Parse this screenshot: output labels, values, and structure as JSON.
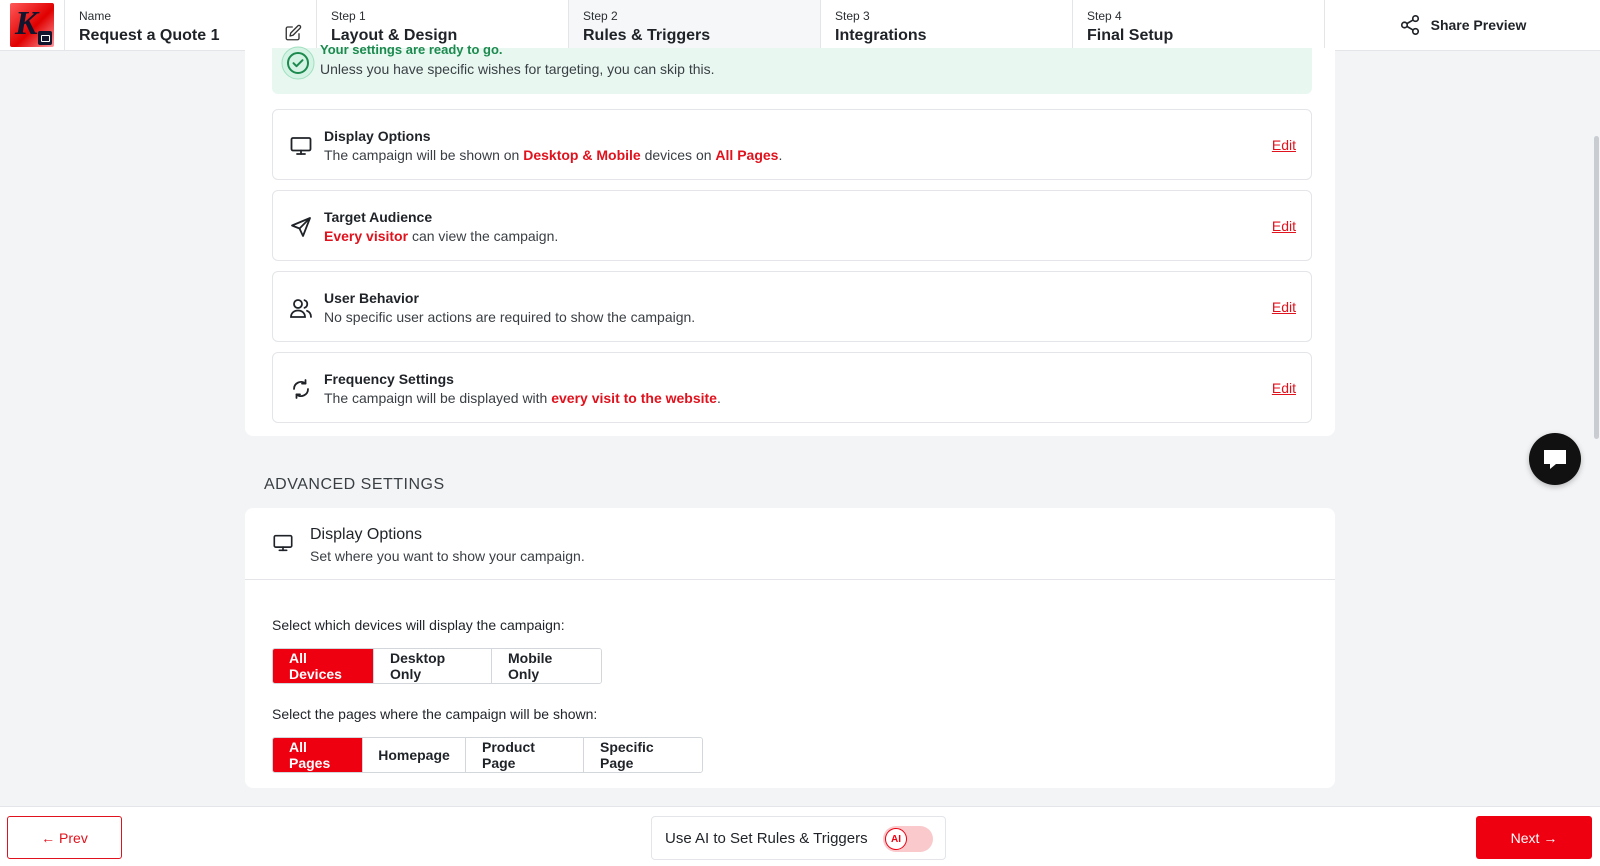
{
  "header": {
    "name_label": "Name",
    "name_value": "Request a Quote 1",
    "steps": [
      {
        "step": "Step 1",
        "title": "Layout & Design"
      },
      {
        "step": "Step 2",
        "title": "Rules & Triggers"
      },
      {
        "step": "Step 3",
        "title": "Integrations"
      },
      {
        "step": "Step 4",
        "title": "Final Setup"
      }
    ],
    "share_label": "Share Preview"
  },
  "ready_banner": {
    "title": "Your settings are ready to go.",
    "subtitle": "Unless you have specific wishes for targeting, you can skip this."
  },
  "summary_rows": [
    {
      "icon": "monitor-icon",
      "title": "Display Options",
      "desc_parts": [
        "The campaign will be shown on ",
        "Desktop & Mobile",
        " devices on ",
        "All Pages",
        "."
      ],
      "edit": "Edit"
    },
    {
      "icon": "send-icon",
      "title": "Target Audience",
      "desc_parts": [
        "Every visitor",
        " can view the campaign."
      ],
      "edit": "Edit"
    },
    {
      "icon": "users-icon",
      "title": "User Behavior",
      "desc_parts": [
        "No specific user actions are required to show the campaign."
      ],
      "edit": "Edit"
    },
    {
      "icon": "refresh-icon",
      "title": "Frequency Settings",
      "desc_parts": [
        "The campaign will be displayed with ",
        "every visit to the website",
        "."
      ],
      "edit": "Edit"
    }
  ],
  "advanced": {
    "section_label": "ADVANCED SETTINGS",
    "title": "Display Options",
    "subtitle": "Set where you want to show your campaign.",
    "devices_question": "Select which devices will display the campaign:",
    "devices": [
      "All Devices",
      "Desktop Only",
      "Mobile Only"
    ],
    "devices_selected": "All Devices",
    "pages_question": "Select the pages where the campaign will be shown:",
    "pages": [
      "All Pages",
      "Homepage",
      "Product Page",
      "Specific Page"
    ],
    "pages_selected": "All Pages"
  },
  "footer": {
    "prev": "← Prev",
    "ai_label": "Use AI to Set Rules & Triggers",
    "ai_badge": "AI",
    "next": "Next →"
  },
  "colors": {
    "accent": "#ee0010",
    "success": "#1c8a4e",
    "banner_bg": "#e8f8f1"
  }
}
